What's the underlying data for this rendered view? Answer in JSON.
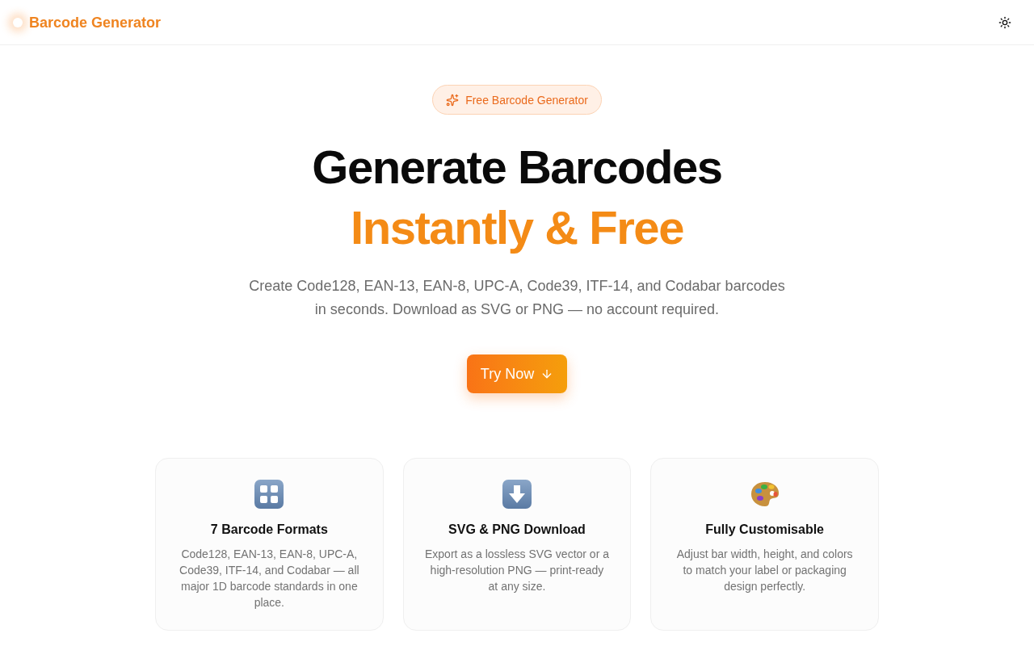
{
  "header": {
    "brand": "Barcode Generator"
  },
  "hero": {
    "badge": "Free Barcode Generator",
    "title_line_1": "Generate Barcodes",
    "title_line_2": "Instantly & Free",
    "description": "Create Code128, EAN-13, EAN-8, UPC-A, Code39, ITF-14, and Codabar barcodes in seconds. Download as SVG or PNG — no account required.",
    "cta": "Try Now"
  },
  "features": [
    {
      "kind": "grid",
      "title": "7 Barcode Formats",
      "text": "Code128, EAN-13, EAN-8, UPC-A, Code39, ITF-14, and Codabar — all major 1D barcode standards in one place."
    },
    {
      "kind": "download",
      "title": "SVG & PNG Download",
      "text": "Export as a lossless SVG vector or a high-resolution PNG — print-ready at any size."
    },
    {
      "kind": "palette",
      "title": "Fully Customisable",
      "text": "Adjust bar width, height, and colors to match your label or packaging design perfectly."
    }
  ]
}
